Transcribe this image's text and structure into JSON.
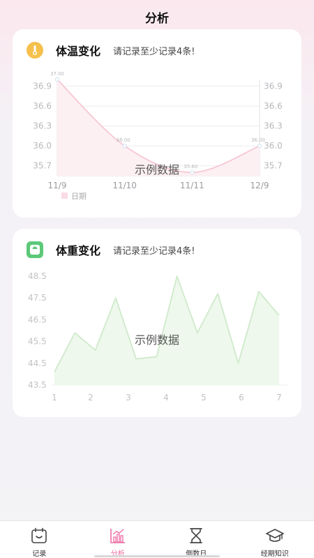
{
  "header": {
    "title": "分析"
  },
  "temp_card": {
    "title": "体温变化",
    "hint": "请记录至少记录4条!",
    "watermark": "示例数据",
    "legend": "日期"
  },
  "weight_card": {
    "title": "体重变化",
    "hint": "请记录至少记录4条!",
    "watermark": "示例数据"
  },
  "colors": {
    "accent": "#ee6da3",
    "temp_line": "#f7c6d4",
    "weight_line": "#cfeacb",
    "weight_fill": "#eef8ec"
  },
  "tabs": [
    {
      "label": "记录",
      "icon": "calendar-icon",
      "active": false
    },
    {
      "label": "分析",
      "icon": "chart-icon",
      "active": true
    },
    {
      "label": "倒数日",
      "icon": "hourglass-icon",
      "active": false
    },
    {
      "label": "经期知识",
      "icon": "graduation-cap-icon",
      "active": false
    }
  ],
  "chart_data": [
    {
      "type": "line",
      "categories": [
        "11/9",
        "11/10",
        "11/11",
        "12/9"
      ],
      "values": [
        37.0,
        36.0,
        35.6,
        36.0
      ],
      "data_labels": [
        "37.00",
        "36.00",
        "35.60",
        "36.00"
      ],
      "yticks": [
        "36.9",
        "36.6",
        "36.3",
        "36.0",
        "35.7"
      ],
      "ylim": [
        35.55,
        37.0
      ],
      "legend": "top-left below chart",
      "grid": true
    },
    {
      "type": "area",
      "x": [
        "1",
        "2",
        "3",
        "4",
        "5",
        "6",
        "7"
      ],
      "values": [
        44.1,
        45.9,
        45.1,
        47.5,
        44.7,
        44.8,
        48.5,
        45.9,
        47.7,
        44.5,
        47.8,
        46.7
      ],
      "yticks": [
        "48.5",
        "47.5",
        "46.5",
        "45.5",
        "44.5",
        "43.5"
      ],
      "ylim": [
        43.5,
        48.5
      ],
      "grid": false
    }
  ]
}
